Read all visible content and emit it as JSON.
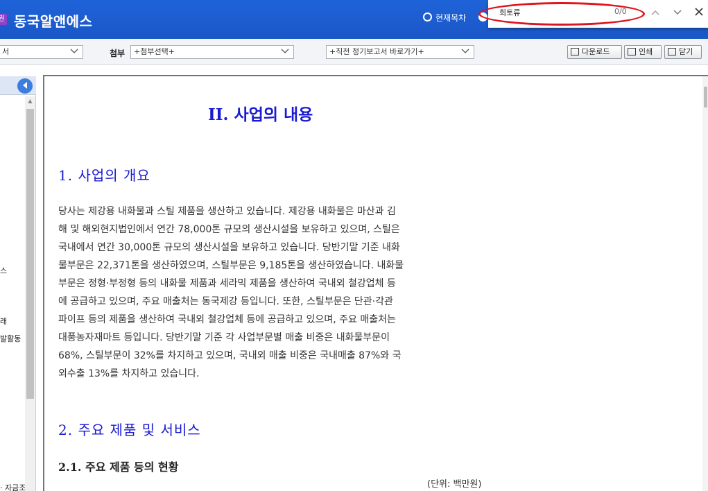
{
  "header": {
    "app_badge": "권",
    "app_title": "동국알앤에스",
    "toc_radio_label": "현재목차"
  },
  "findbar": {
    "query": "희토류",
    "count": "0/0",
    "prev_icon": "chevron-up-icon",
    "next_icon": "chevron-down-icon",
    "close_icon": "close-icon"
  },
  "toolbar": {
    "report_select_fragment": "서",
    "attach_label": "첨부",
    "attach_select": "+첨부선택+",
    "periodic_select": "+직전 정기보고서 바로가기+",
    "download_label": "다운로드",
    "print_label": "인쇄",
    "close_label": "닫기"
  },
  "left_panel": {
    "fragments": [
      "스",
      "래",
      "발활동",
      "· 자금조"
    ]
  },
  "document": {
    "section_title": "II. 사업의 내용",
    "heading1": "1. 사업의 개요",
    "paragraph_lines": [
      "당사는 제강용 내화물과 스틸 제품을 생산하고 있습니다. 제강용 내화물은 마산과 김",
      "해 및 해외현지법인에서 연간 78,000톤 규모의 생산시설을 보유하고 있으며, 스틸은",
      "국내에서 연간 30,000톤 규모의 생산시설을 보유하고 있습니다. 당반기말 기준 내화",
      "물부문은 22,371톤을 생산하였으며, 스틸부문은 9,185톤을 생산하였습니다. 내화물",
      "부문은 정형·부정형 등의 내화물 제품과 세라믹 제품을 생산하여 국내외 철강업체 등",
      "에 공급하고 있으며, 주요 매출처는 동국제강 등입니다. 또한, 스틸부문은 단관·각관",
      "파이프 등의 제품을 생산하여 국내외 철강업체 등에 공급하고 있으며, 주요 매출처는",
      "대풍농자재마트 등입니다. 당반기말 기준 각 사업부문별 매출 비중은 내화물부문이",
      "68%, 스틸부문이 32%를 차지하고 있으며, 국내외 매출 비중은 국내매출 87%와 국",
      "외수출 13%를 차지하고 있습니다."
    ],
    "heading2": "2. 주요 제품 및 서비스",
    "subheading": "2.1. 주요 제품 등의 현황",
    "unit_note": "(단위: 백만원)"
  },
  "colors": {
    "header_blue": "#1f63d9",
    "heading_blue": "#1a1ad0",
    "highlight_red": "#e0141e"
  }
}
